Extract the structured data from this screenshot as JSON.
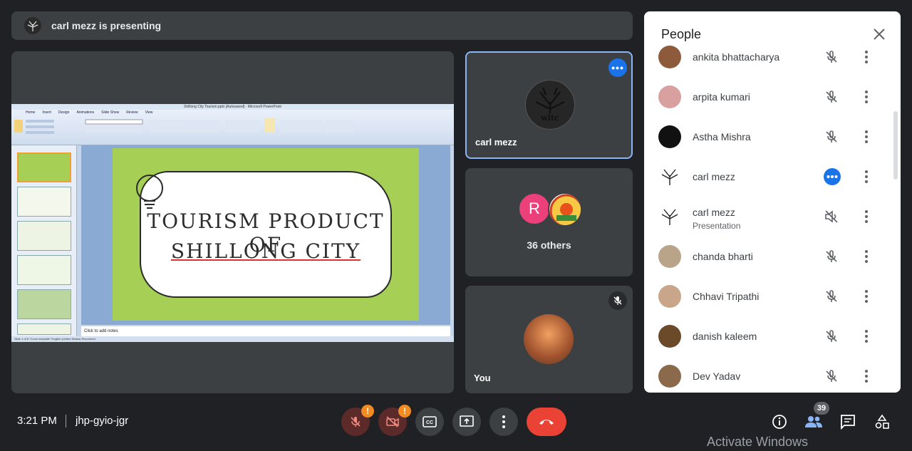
{
  "banner": {
    "text": "carl mezz is presenting"
  },
  "presentation": {
    "window_title": "Shillong City Tourism.pptx [Autosaved] - Microsoft PowerPoint",
    "ribbon_tabs": [
      "Home",
      "Insert",
      "Design",
      "Animations",
      "Slide Show",
      "Review",
      "View"
    ],
    "slide_title_line1": "TOURISM PRODUCT OF",
    "slide_title_line2": "SHILLONG CITY",
    "notes_placeholder": "Click to add notes",
    "status_bar": "Slide 1 of 8   \"Curve-template\"   English (United States)   Recovered"
  },
  "tiles": {
    "presenter": {
      "name": "carl mezz"
    },
    "others": {
      "label": "36 others",
      "initial": "R"
    },
    "self": {
      "name": "You"
    }
  },
  "people_panel": {
    "title": "People",
    "participants": [
      {
        "name": "ankita bhattacharya",
        "sub": "",
        "mic": "muted"
      },
      {
        "name": "arpita kumari",
        "sub": "",
        "mic": "muted"
      },
      {
        "name": "Astha Mishra",
        "sub": "",
        "mic": "muted"
      },
      {
        "name": "carl mezz",
        "sub": "",
        "mic": "more"
      },
      {
        "name": "carl mezz",
        "sub": "Presentation",
        "mic": "audio-off"
      },
      {
        "name": "chanda bharti",
        "sub": "",
        "mic": "muted"
      },
      {
        "name": "Chhavi Tripathi",
        "sub": "",
        "mic": "muted"
      },
      {
        "name": "danish kaleem",
        "sub": "",
        "mic": "muted"
      },
      {
        "name": "Dev Yadav",
        "sub": "",
        "mic": "muted"
      }
    ]
  },
  "bottom_bar": {
    "time": "3:21 PM",
    "meeting_code": "jhp-gyio-jgr",
    "people_count": "39",
    "warning_glyph": "!"
  },
  "watermark": "Activate Windows",
  "colors": {
    "accent": "#1a73e8",
    "leave": "#ea4335",
    "warning": "#f28b21",
    "bg": "#202124"
  }
}
